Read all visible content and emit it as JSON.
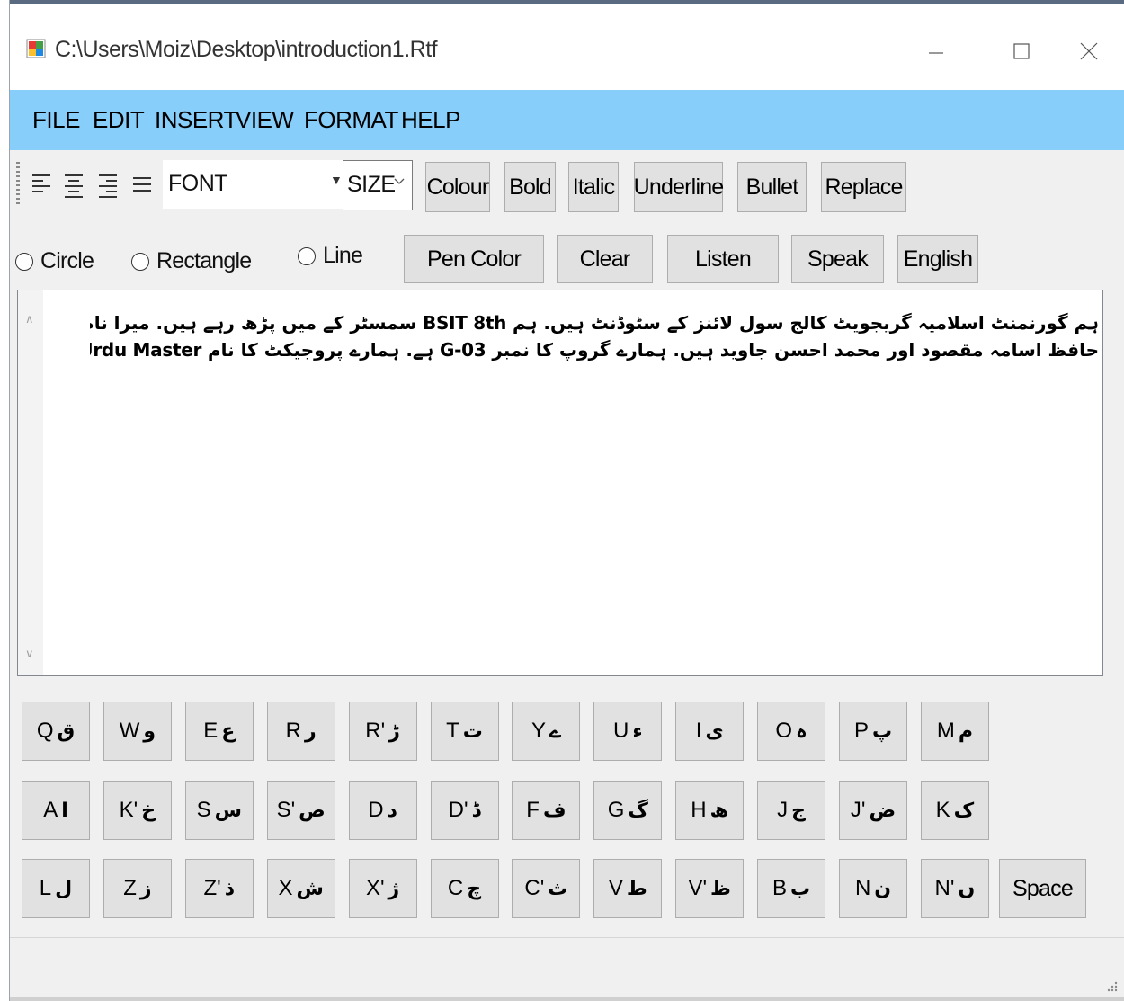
{
  "window": {
    "title": "C:\\Users\\Moiz\\Desktop\\introduction1.Rtf",
    "minimize": "—",
    "maximize": "☐",
    "close": "X"
  },
  "menu": [
    "FILE",
    "EDIT",
    "INSERT",
    "VIEW",
    "FORMAT",
    "HELP"
  ],
  "toolbar": {
    "font_label": "FONT",
    "size_label": "SIZE",
    "buttons": [
      "Colour",
      "Bold",
      "Italic",
      "Underline",
      "Bullet",
      "Replace"
    ]
  },
  "drawing": {
    "radios": [
      "Circle",
      "Rectangle",
      "Line"
    ],
    "buttons": [
      "Pen Color",
      "Clear",
      "Listen",
      "Speak",
      "English"
    ]
  },
  "editor": {
    "line1": "ہم گورنمنٹ اسلامیہ گریجویٹ کالج سول لائنز کے سٹوڈنٹ ہیں. ہم BSIT 8th سمسٹر کے میں پڑھ رہے ہیں. میرا نام معیز اجمل ہے. میرے گروپ ممبرز کے نام",
    "line2": "حافظ اسامہ مقصود اور محمد احسن جاوید ہیں. ہمارے گروپ کا نمبر G-03 ہے. ہمارے پروجیکٹ کا نام Urdu Master ہے."
  },
  "keyboard": {
    "row1": [
      {
        "latin": "Q",
        "urdu": "ق"
      },
      {
        "latin": "W",
        "urdu": "و"
      },
      {
        "latin": "E",
        "urdu": "ع"
      },
      {
        "latin": "R",
        "urdu": "ر"
      },
      {
        "latin": "R'",
        "urdu": "ڑ"
      },
      {
        "latin": "T",
        "urdu": "ت"
      },
      {
        "latin": "Y",
        "urdu": "ے"
      },
      {
        "latin": "U",
        "urdu": "ء"
      },
      {
        "latin": "I",
        "urdu": "ی"
      },
      {
        "latin": "O",
        "urdu": "ہ"
      },
      {
        "latin": "P",
        "urdu": "پ"
      },
      {
        "latin": "M",
        "urdu": "م"
      }
    ],
    "row2": [
      {
        "latin": "A",
        "urdu": "ا"
      },
      {
        "latin": "K'",
        "urdu": "خ"
      },
      {
        "latin": "S",
        "urdu": "س"
      },
      {
        "latin": "S'",
        "urdu": "ص"
      },
      {
        "latin": "D",
        "urdu": "د"
      },
      {
        "latin": "D'",
        "urdu": "ڈ"
      },
      {
        "latin": "F",
        "urdu": "ف"
      },
      {
        "latin": "G",
        "urdu": "گ"
      },
      {
        "latin": "H",
        "urdu": "ھ"
      },
      {
        "latin": "J",
        "urdu": "ج"
      },
      {
        "latin": "J'",
        "urdu": "ض"
      },
      {
        "latin": "K",
        "urdu": "ک"
      }
    ],
    "row3": [
      {
        "latin": "L",
        "urdu": "ل"
      },
      {
        "latin": "Z",
        "urdu": "ز"
      },
      {
        "latin": "Z'",
        "urdu": "ذ"
      },
      {
        "latin": "X",
        "urdu": "ش"
      },
      {
        "latin": "X'",
        "urdu": "ژ"
      },
      {
        "latin": "C",
        "urdu": "چ"
      },
      {
        "latin": "C'",
        "urdu": "ث"
      },
      {
        "latin": "V",
        "urdu": "ط"
      },
      {
        "latin": "V'",
        "urdu": "ظ"
      },
      {
        "latin": "B",
        "urdu": "ب"
      },
      {
        "latin": "N",
        "urdu": "ن"
      },
      {
        "latin": "N'",
        "urdu": "ں"
      }
    ],
    "space": "Space"
  }
}
